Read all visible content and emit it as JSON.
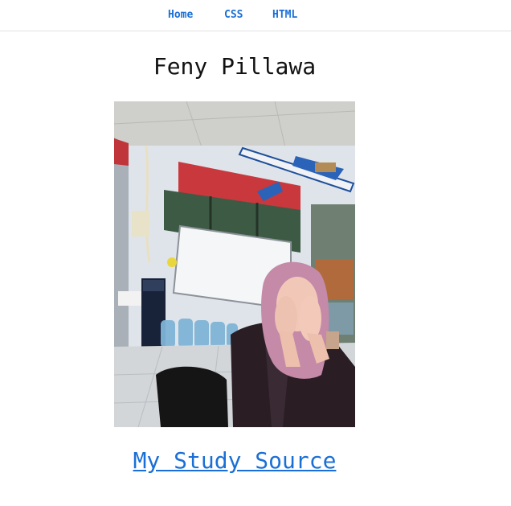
{
  "nav": {
    "items": [
      {
        "label": "Home"
      },
      {
        "label": "CSS"
      },
      {
        "label": "HTML"
      }
    ]
  },
  "page": {
    "title": "Feny Pillawa"
  },
  "links": {
    "study_source": "My Study Source"
  },
  "colors": {
    "link": "#1a6fd6",
    "title": "#111111",
    "divider": "#e2e2e2"
  }
}
